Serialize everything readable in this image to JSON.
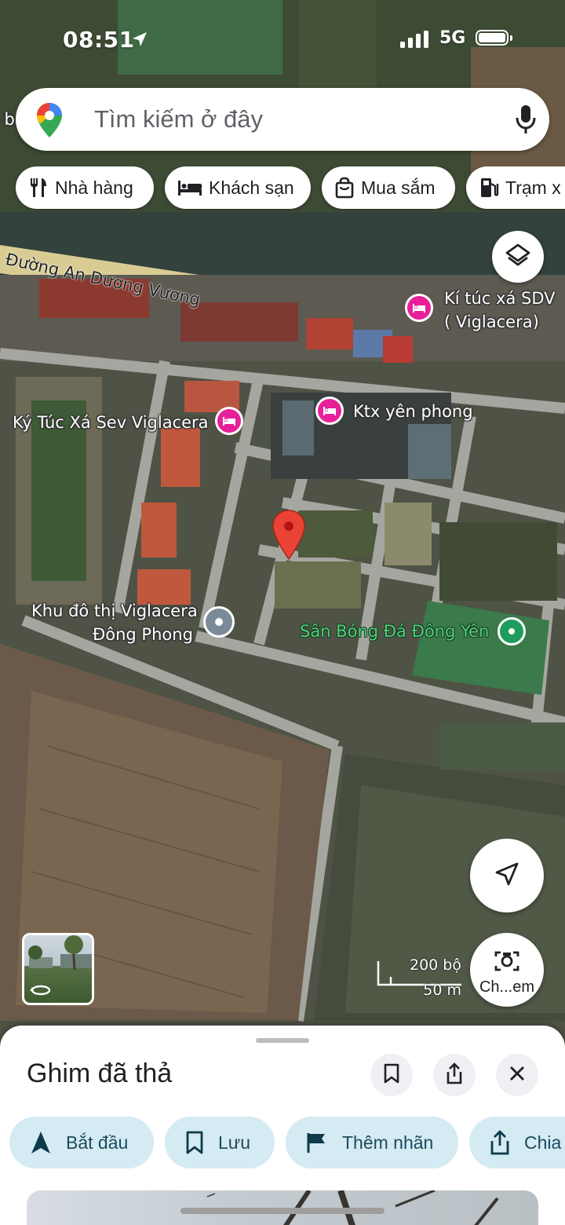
{
  "status_bar": {
    "time": "08:51",
    "network": "5G"
  },
  "search": {
    "placeholder": "Tìm kiếm ở đây"
  },
  "chips": [
    {
      "label": "Nhà hàng",
      "icon": "restaurant-icon"
    },
    {
      "label": "Khách sạn",
      "icon": "bed-icon"
    },
    {
      "label": "Mua sắm",
      "icon": "shopping-bag-icon"
    },
    {
      "label": "Trạm x",
      "icon": "gas-station-icon"
    }
  ],
  "map": {
    "road_label": "Đường An Dương Vương",
    "edge_label": "o b",
    "places": [
      {
        "name_line1": "Kí túc xá SDV",
        "name_line2": "( Viglacera)",
        "type": "hotel"
      },
      {
        "name": "Ktx yên phong",
        "type": "hotel"
      },
      {
        "name": "Ký Túc Xá Sev Viglacera",
        "type": "hotel"
      },
      {
        "name_line1": "Khu đô thị Viglacera",
        "name_line2": "Đông Phong",
        "type": "locality"
      },
      {
        "name": "Sân Bóng Đá Đông Yên",
        "type": "park"
      }
    ],
    "scale": {
      "imperial": "200 bộ",
      "metric": "50 m"
    },
    "camera_label": "Ch...em",
    "colors": {
      "pin": "#ea4335",
      "hotel_poi": "#e7209a",
      "park_poi": "#1e9c5a"
    }
  },
  "sheet": {
    "title": "Ghim đã thả",
    "actions": [
      {
        "label": "Bắt đầu",
        "icon": "navigate-icon"
      },
      {
        "label": "Lưu",
        "icon": "bookmark-icon"
      },
      {
        "label": "Thêm nhãn",
        "icon": "flag-icon"
      },
      {
        "label": "Chia",
        "icon": "share-icon"
      }
    ]
  }
}
